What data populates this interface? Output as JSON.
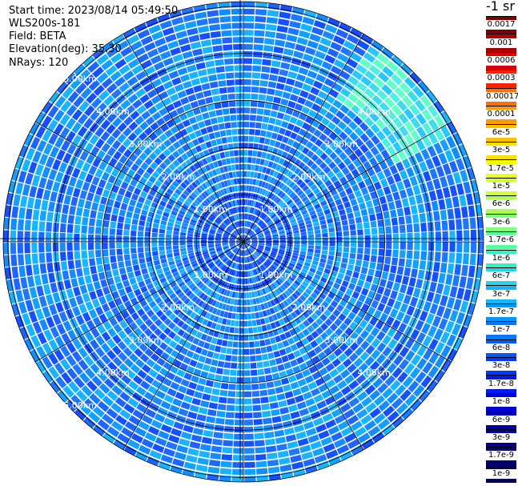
{
  "info": {
    "start_time": "Start time: 2023/08/14 05:49:50",
    "instrument": "WLS200s-181",
    "field": "Field: BETA",
    "elevation": "Elevation(deg): 35.30",
    "nrays": "NRays: 120"
  },
  "colorbar": {
    "unit_label": "-1 sr",
    "labels": [
      "0.0017",
      "0.001",
      "0.0006",
      "0.0003",
      "0.00017",
      "0.0001",
      "6e-5",
      "3e-5",
      "1.7e-5",
      "1e-5",
      "6e-6",
      "3e-6",
      "1.7e-6",
      "1e-6",
      "6e-7",
      "3e-7",
      "1.7e-7",
      "1e-7",
      "6e-8",
      "3e-8",
      "1.7e-8",
      "1e-8",
      "6e-9",
      "3e-9",
      "1.7e-9",
      "1e-9"
    ],
    "colors": [
      "#800000",
      "#b00000",
      "#dd0000",
      "#ff2000",
      "#ff7000",
      "#ff9a00",
      "#ffc000",
      "#ffe000",
      "#f0ff10",
      "#d0ff30",
      "#a8ff50",
      "#80ff78",
      "#58ffa0",
      "#30f0c8",
      "#20d8e8",
      "#10b8ff",
      "#0098ff",
      "#0078ff",
      "#0058ff",
      "#0038ff",
      "#0018f0",
      "#0000d8",
      "#0000b0",
      "#000090",
      "#000070",
      "#000050"
    ]
  },
  "chart_data": {
    "type": "heatmap",
    "projection": "polar (PPI scan)",
    "field": "BETA",
    "nrays": 120,
    "range_rings_km": [
      "1.00km",
      "2.00km",
      "3.00km",
      "4.00km",
      "5.00km"
    ],
    "max_range_km": 5.2,
    "dominant_value": "3e-8 to 1e-7",
    "feature": "stronger return band (~1.7e-6 to 1e-5) near 4.5 km range, NE sector",
    "colorbar_scale": "log"
  }
}
